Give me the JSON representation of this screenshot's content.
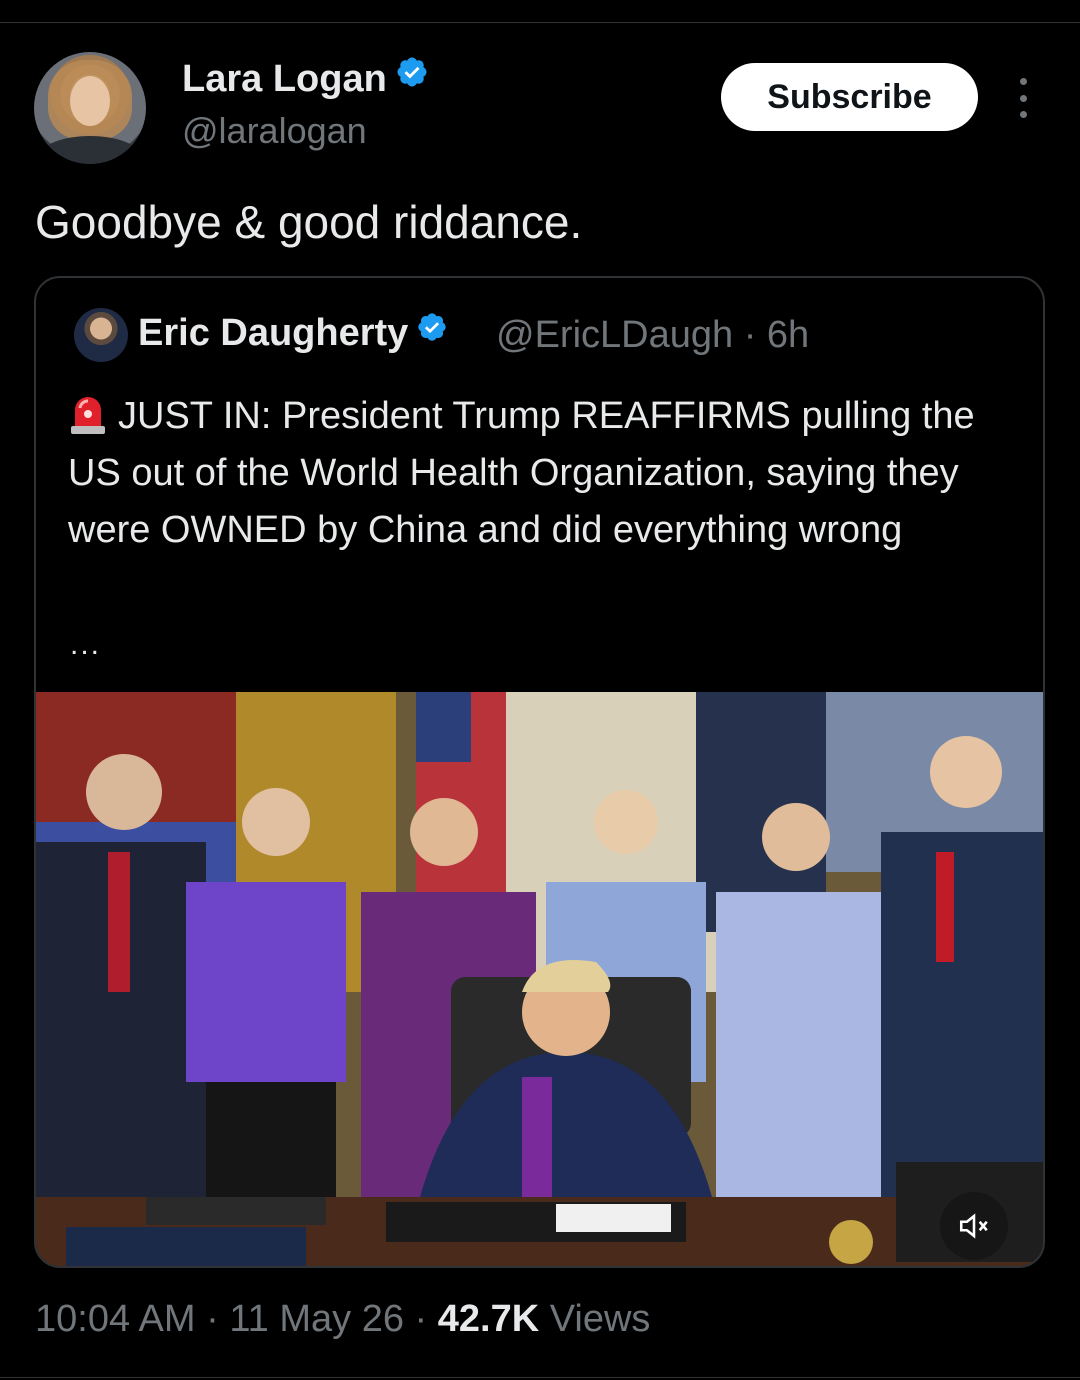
{
  "author": {
    "name": "Lara Logan",
    "handle": "@laralogan",
    "verified_icon": "verified-badge-icon"
  },
  "header": {
    "subscribe_label": "Subscribe",
    "more_icon": "more-vertical-icon"
  },
  "tweet": {
    "text": "Goodbye & good riddance."
  },
  "quote": {
    "name": "Eric Daugherty",
    "handle": "@EricLDaugh",
    "separator": "·",
    "age": "6h",
    "siren_icon": "siren-emoji-icon",
    "text": "JUST IN: President Trump REAFFIRMS pulling the US out of the World Health Organization, saying they were OWNED by China and did everything wrong",
    "ellipsis": "...",
    "media_mute_icon": "speaker-muted-icon"
  },
  "meta": {
    "time": "10:04 AM",
    "sep1": "·",
    "date": "11 May 26",
    "sep2": "·",
    "views_count": "42.7K",
    "views_label": "Views"
  },
  "colors": {
    "background": "#000000",
    "text": "#e7e9ea",
    "muted": "#71767b",
    "border": "#2f3336",
    "verified_blue": "#1d9bf0"
  }
}
